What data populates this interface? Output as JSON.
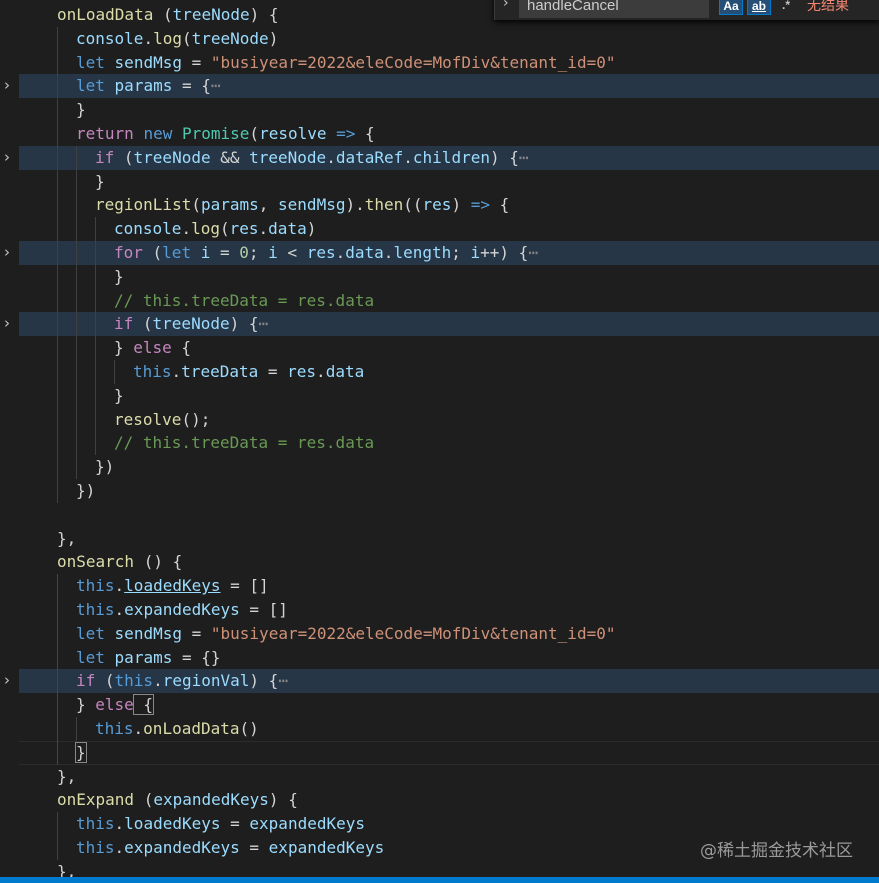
{
  "find_widget": {
    "query": "handleCancel",
    "match_case_label": "Aa",
    "whole_word_label": "ab",
    "regex_label": ".*",
    "result_text": "无结果"
  },
  "icons": {
    "fold": "chevron-right-icon",
    "widget_toggle": "chevron-right-icon"
  },
  "fold_marker": "⋯",
  "watermark": "@稀土掘金技术社区",
  "colors": {
    "background": "#1e1e1e",
    "folded_line_highlight": "#263646",
    "status_bar": "#007acc",
    "keyword": "#569cd6",
    "control": "#c586c0",
    "string": "#ce9178",
    "function": "#dcdcaa",
    "variable": "#9cdcfe",
    "comment": "#6a9955"
  },
  "lines": [
    [
      [
        "f",
        "onLoadData"
      ],
      [
        "p",
        " ("
      ],
      [
        "v",
        "treeNode"
      ],
      [
        "p",
        ") {"
      ]
    ],
    [
      [
        "v",
        "console"
      ],
      [
        "p",
        "."
      ],
      [
        "f",
        "log"
      ],
      [
        "p",
        "("
      ],
      [
        "v",
        "treeNode"
      ],
      [
        "p",
        ")"
      ]
    ],
    [
      [
        "k",
        "let"
      ],
      [
        "p",
        " "
      ],
      [
        "v",
        "sendMsg"
      ],
      [
        "p",
        " = "
      ],
      [
        "s",
        "\"busiyear=2022&eleCode=MofDiv&tenant_id=0\""
      ]
    ],
    [
      [
        "k",
        "let"
      ],
      [
        "p",
        " "
      ],
      [
        "v",
        "params"
      ],
      [
        "p",
        " = {"
      ],
      [
        "e",
        "⋯"
      ]
    ],
    [
      [
        "p",
        "}"
      ]
    ],
    [
      [
        "c",
        "return"
      ],
      [
        "p",
        " "
      ],
      [
        "k",
        "new"
      ],
      [
        "p",
        " "
      ],
      [
        "t",
        "Promise"
      ],
      [
        "p",
        "("
      ],
      [
        "v",
        "resolve"
      ],
      [
        "p",
        " "
      ],
      [
        "k",
        "=>"
      ],
      [
        "p",
        " {"
      ]
    ],
    [
      [
        "c",
        "if"
      ],
      [
        "p",
        " ("
      ],
      [
        "v",
        "treeNode"
      ],
      [
        "p",
        " && "
      ],
      [
        "v",
        "treeNode"
      ],
      [
        "p",
        "."
      ],
      [
        "v",
        "dataRef"
      ],
      [
        "p",
        "."
      ],
      [
        "v",
        "children"
      ],
      [
        "p",
        ") {"
      ],
      [
        "e",
        "⋯"
      ]
    ],
    [
      [
        "p",
        "}"
      ]
    ],
    [
      [
        "f",
        "regionList"
      ],
      [
        "p",
        "("
      ],
      [
        "v",
        "params"
      ],
      [
        "p",
        ", "
      ],
      [
        "v",
        "sendMsg"
      ],
      [
        "p",
        ")."
      ],
      [
        "f",
        "then"
      ],
      [
        "p",
        "(("
      ],
      [
        "v",
        "res"
      ],
      [
        "p",
        ") "
      ],
      [
        "k",
        "=>"
      ],
      [
        "p",
        " {"
      ]
    ],
    [
      [
        "v",
        "console"
      ],
      [
        "p",
        "."
      ],
      [
        "f",
        "log"
      ],
      [
        "p",
        "("
      ],
      [
        "v",
        "res"
      ],
      [
        "p",
        "."
      ],
      [
        "v",
        "data"
      ],
      [
        "p",
        ")"
      ]
    ],
    [
      [
        "c",
        "for"
      ],
      [
        "p",
        " ("
      ],
      [
        "k",
        "let"
      ],
      [
        "p",
        " "
      ],
      [
        "v",
        "i"
      ],
      [
        "p",
        " = "
      ],
      [
        "n",
        "0"
      ],
      [
        "p",
        "; "
      ],
      [
        "v",
        "i"
      ],
      [
        "p",
        " < "
      ],
      [
        "v",
        "res"
      ],
      [
        "p",
        "."
      ],
      [
        "v",
        "data"
      ],
      [
        "p",
        "."
      ],
      [
        "v",
        "length"
      ],
      [
        "p",
        "; "
      ],
      [
        "v",
        "i"
      ],
      [
        "p",
        "++) {"
      ],
      [
        "e",
        "⋯"
      ]
    ],
    [
      [
        "p",
        "}"
      ]
    ],
    [
      [
        "m",
        "// this.treeData = res.data"
      ]
    ],
    [
      [
        "c",
        "if"
      ],
      [
        "p",
        " ("
      ],
      [
        "v",
        "treeNode"
      ],
      [
        "p",
        ") {"
      ],
      [
        "e",
        "⋯"
      ]
    ],
    [
      [
        "p",
        "} "
      ],
      [
        "c",
        "else"
      ],
      [
        "p",
        " {"
      ]
    ],
    [
      [
        "k",
        "this"
      ],
      [
        "p",
        "."
      ],
      [
        "v",
        "treeData"
      ],
      [
        "p",
        " = "
      ],
      [
        "v",
        "res"
      ],
      [
        "p",
        "."
      ],
      [
        "v",
        "data"
      ]
    ],
    [
      [
        "p",
        "}"
      ]
    ],
    [
      [
        "f",
        "resolve"
      ],
      [
        "p",
        "();"
      ]
    ],
    [
      [
        "m",
        "// this.treeData = res.data"
      ]
    ],
    [
      [
        "p",
        "})"
      ]
    ],
    [
      [
        "p",
        "})"
      ]
    ],
    [],
    [
      [
        "p",
        "},"
      ]
    ],
    [
      [
        "f",
        "onSearch"
      ],
      [
        "p",
        " () {"
      ]
    ],
    [
      [
        "k",
        "this"
      ],
      [
        "p",
        "."
      ],
      [
        "v",
        "loadedKeys"
      ],
      [
        "p",
        " = []"
      ]
    ],
    [
      [
        "k",
        "this"
      ],
      [
        "p",
        "."
      ],
      [
        "v",
        "expandedKeys"
      ],
      [
        "p",
        " = []"
      ]
    ],
    [
      [
        "k",
        "let"
      ],
      [
        "p",
        " "
      ],
      [
        "v",
        "sendMsg"
      ],
      [
        "p",
        " = "
      ],
      [
        "s",
        "\"busiyear=2022&eleCode=MofDiv&tenant_id=0\""
      ]
    ],
    [
      [
        "k",
        "let"
      ],
      [
        "p",
        " "
      ],
      [
        "v",
        "params"
      ],
      [
        "p",
        " = {}"
      ]
    ],
    [
      [
        "c",
        "if"
      ],
      [
        "p",
        " ("
      ],
      [
        "k",
        "this"
      ],
      [
        "p",
        "."
      ],
      [
        "v",
        "regionVal"
      ],
      [
        "p",
        ") {"
      ],
      [
        "e",
        "⋯"
      ]
    ],
    [
      [
        "p",
        "} "
      ],
      [
        "c",
        "else"
      ],
      [
        "p",
        " {"
      ]
    ],
    [
      [
        "k",
        "this"
      ],
      [
        "p",
        "."
      ],
      [
        "f",
        "onLoadData"
      ],
      [
        "p",
        "()"
      ]
    ],
    [
      [
        "p",
        "}"
      ]
    ],
    [
      [
        "p",
        "},"
      ]
    ],
    [
      [
        "f",
        "onExpand"
      ],
      [
        "p",
        " ("
      ],
      [
        "v",
        "expandedKeys"
      ],
      [
        "p",
        ") {"
      ]
    ],
    [
      [
        "k",
        "this"
      ],
      [
        "p",
        "."
      ],
      [
        "v",
        "loadedKeys"
      ],
      [
        "p",
        " = "
      ],
      [
        "v",
        "expandedKeys"
      ]
    ],
    [
      [
        "k",
        "this"
      ],
      [
        "p",
        "."
      ],
      [
        "v",
        "expandedKeys"
      ],
      [
        "p",
        " = "
      ],
      [
        "v",
        "expandedKeys"
      ]
    ],
    [
      [
        "p",
        "},"
      ]
    ]
  ]
}
